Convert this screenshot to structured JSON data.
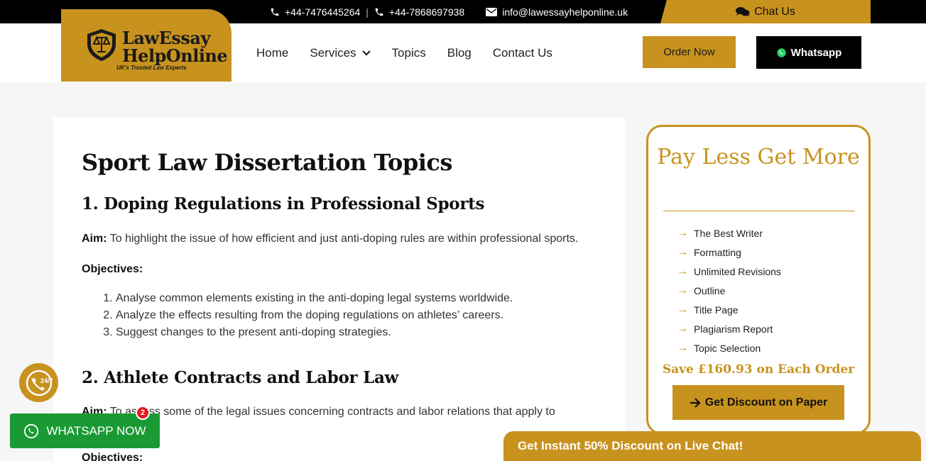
{
  "topbar": {
    "phone1": "+44-7476445264",
    "separator": "|",
    "phone2": "+44-7868697938",
    "email": "info@lawessayhelponline.uk",
    "chat_label": "Chat Us"
  },
  "logo": {
    "line1": "LawEssay",
    "line2_a": "Help",
    "line2_b": "Online",
    "tagline": "UK's Trusted Law Experts"
  },
  "nav": {
    "items": [
      "Home",
      "Services",
      "Topics",
      "Blog",
      "Contact Us"
    ]
  },
  "header_buttons": {
    "order": "Order Now",
    "whatsapp": "Whatsapp"
  },
  "article": {
    "title": "Sport Law Dissertation Topics",
    "sections": [
      {
        "heading": "1. Doping Regulations in Professional Sports",
        "aim_label": "Aim:",
        "aim_text": " To highlight the issue of how efficient and just anti-doping rules are within professional sports.",
        "objectives_label": "Objectives:",
        "objectives": [
          "Analyse common elements existing in the anti-doping legal systems worldwide.",
          "Analyze the effects resulting from the doping regulations on athletes’ careers.",
          "Suggest changes to the present anti-doping strategies."
        ]
      },
      {
        "heading": "2. Athlete Contracts and Labor Law",
        "aim_label": "Aim:",
        "aim_text": " To assess some of the legal issues concerning contracts and labor relations that apply to",
        "objectives_label": "Objectives:"
      }
    ]
  },
  "sidebar": {
    "heading": "Pay Less Get More",
    "features": [
      "The Best Writer",
      "Formatting",
      "Unlimited Revisions",
      "Outline",
      "Title Page",
      "Plagiarism Report",
      "Topic Selection"
    ],
    "save_text": "Save £160.93 on Each Order",
    "cta": "Get Discount on Paper"
  },
  "widgets": {
    "support_badge": "24/7",
    "whatsapp_now": "WHATSAPP NOW",
    "whatsapp_count": "2",
    "live_chat": "Get Instant 50% Discount on Live Chat!"
  },
  "colors": {
    "brand_gold": "#c8921e",
    "whatsapp_green": "#1a9a34",
    "notification_red": "#e01b1b"
  }
}
